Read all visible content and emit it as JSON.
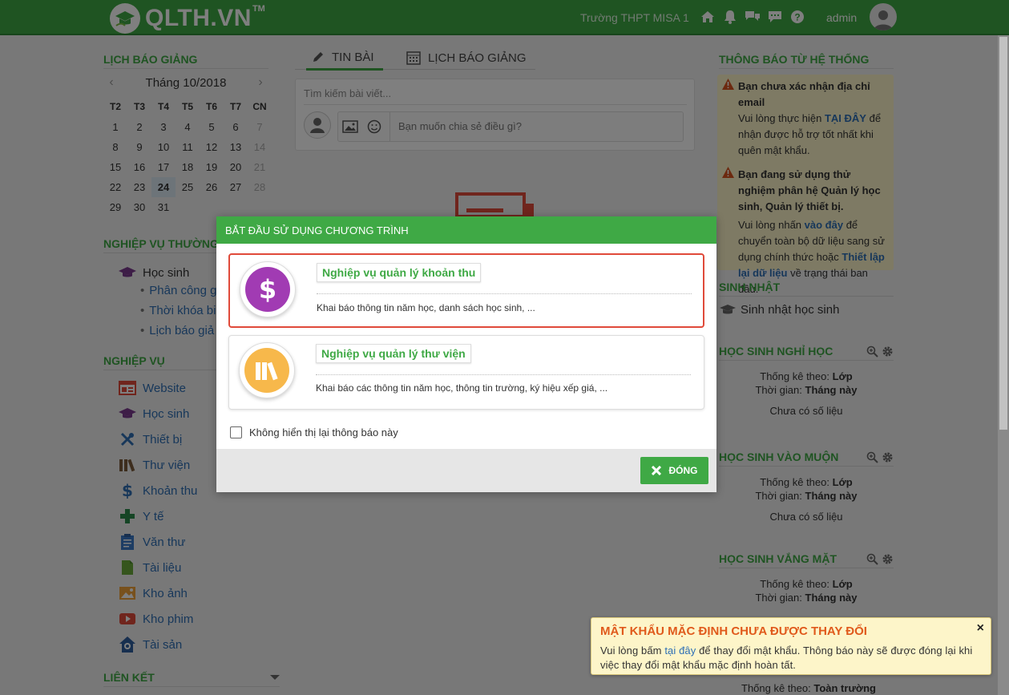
{
  "header": {
    "logo_text": "QLTH.VN",
    "logo_tm": "TM",
    "school": "Trường THPT MISA 1",
    "user": "admin"
  },
  "left": {
    "calendar_title": "LỊCH BÁO GIẢNG",
    "month_label": "Tháng 10/2018",
    "prev": "‹",
    "next": "›",
    "day_names": [
      "T2",
      "T3",
      "T4",
      "T5",
      "T6",
      "T7",
      "CN"
    ],
    "weeks": [
      [
        "1",
        "2",
        "3",
        "4",
        "5",
        "6",
        "7"
      ],
      [
        "8",
        "9",
        "10",
        "11",
        "12",
        "13",
        "14"
      ],
      [
        "15",
        "16",
        "17",
        "18",
        "19",
        "20",
        "21"
      ],
      [
        "22",
        "23",
        "24",
        "25",
        "26",
        "27",
        "28"
      ],
      [
        "29",
        "30",
        "31",
        "",
        "",
        "",
        ""
      ]
    ],
    "today": "24",
    "common_title": "NGHIỆP VỤ THƯỜNG DÙ",
    "common_group": "Học sinh",
    "common_items": [
      "Phân công g",
      "Thời khóa bi",
      "Lịch báo giả"
    ],
    "business_title": "NGHIỆP VỤ",
    "business_items": [
      "Website",
      "Học sinh",
      "Thiết bị",
      "Thư viện",
      "Khoản thu",
      "Y tế",
      "Văn thư",
      "Tài liệu",
      "Kho ảnh",
      "Kho phim",
      "Tài sản"
    ],
    "links_title": "LIÊN KẾT"
  },
  "center": {
    "tab_posts": "TIN BÀI",
    "tab_schedule": "LỊCH BÁO GIẢNG",
    "search_placeholder": "Tìm kiếm bài viết...",
    "share_placeholder": "Bạn muốn chia sẻ điều gì?"
  },
  "right": {
    "sys_title": "THÔNG BÁO TỪ HỆ THỐNG",
    "n1_head": "Bạn chưa xác nhận địa chỉ email",
    "n1_a": "Vui lòng thực hiện",
    "n1_link": "TẠI ĐÂY",
    "n1_b": "để nhận được hỗ trợ tốt nhất khi quên mật khẩu.",
    "n2_head": "Bạn đang sử dụng thử nghiệm phân hệ Quản lý học sinh, Quản lý thiết bị.",
    "n2_a": "Vui lòng nhấn",
    "n2_link1": "vào đây",
    "n2_b": "để chuyển toàn bộ dữ liệu sang sử dụng chính thức hoặc",
    "n2_link2": "Thiết lập lại dữ liệu",
    "n2_c": "về trạng thái ban đầu.",
    "birthday_title": "SINH NHẬT",
    "birthday_item": "Sinh nhật học sinh",
    "absent_title": "HỌC SINH NGHỈ HỌC",
    "late_title": "HỌC SINH VÀO MUỘN",
    "missing_title": "HỌC SINH VẮNG MẶT",
    "stat_by": "Thống kê theo:",
    "stat_by_val": "Lớp",
    "stat_time": "Thời gian:",
    "stat_time_val": "Tháng này",
    "no_data": "Chưa có số liệu",
    "bottom_by_val": "Toàn trường"
  },
  "modal": {
    "title": "BẮT ĐẦU SỬ DỤNG CHƯƠNG TRÌNH",
    "opt1_title": "Nghiệp vụ quản lý khoản thu",
    "opt1_desc": "Khai báo thông tin năm học, danh sách học sinh, ...",
    "opt2_title": "Nghiệp vụ quản lý thư viện",
    "opt2_desc": "Khai báo các thông tin năm học, thông tin trường, ký hiệu xếp giá, ...",
    "checkbox_label": "Không hiển thị lại thông báo này",
    "close_label": "ĐÓNG"
  },
  "toast": {
    "title": "MẬT KHẨU MẶC ĐỊNH CHƯA ĐƯỢC THAY ĐỔI",
    "close": "×",
    "msg_a": "Vui lòng bấm",
    "msg_link": "tại đây",
    "msg_b": "để thay đổi mật khẩu. Thông báo này sẽ được đóng lại khi việc thay đổi mật khẩu mặc định hoàn tất."
  }
}
